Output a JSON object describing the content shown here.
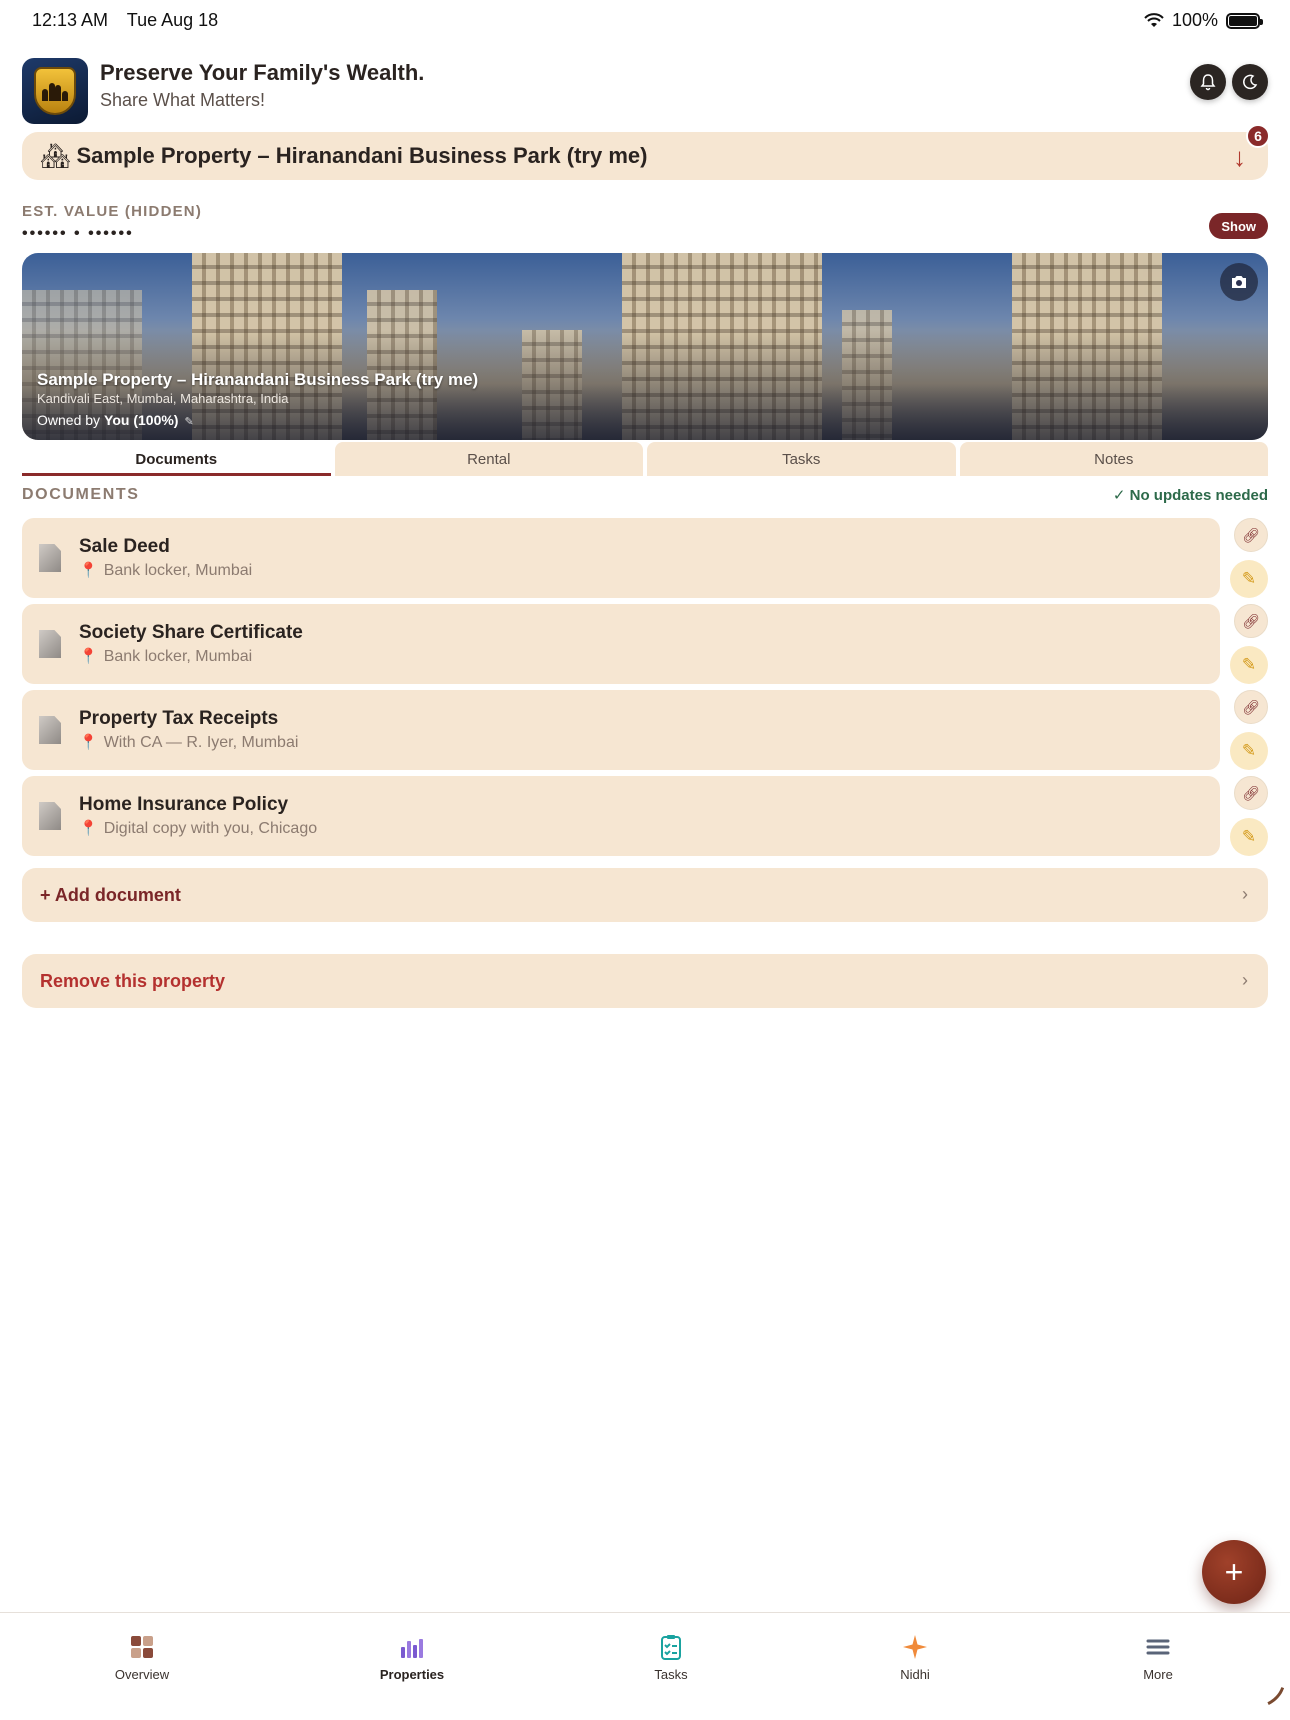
{
  "status_bar": {
    "time": "12:13 AM",
    "date": "Tue Aug 18",
    "battery": "100%"
  },
  "header": {
    "title": "Preserve Your Family's Wealth.",
    "subtitle": "Share What Matters!"
  },
  "property_selector": {
    "name": "Sample Property – Hiranandani Business Park (try me)",
    "badge_count": "6"
  },
  "est_value": {
    "label": "EST. VALUE (HIDDEN)",
    "masked": "•••••• • ••••••",
    "show_label": "Show"
  },
  "hero": {
    "title": "Sample Property – Hiranandani Business Park (try me)",
    "location": "Kandivali East, Mumbai, Maharashtra, India",
    "owned_prefix": "Owned by",
    "owner": "You (100%)"
  },
  "tabs": [
    {
      "label": "Documents"
    },
    {
      "label": "Rental"
    },
    {
      "label": "Tasks"
    },
    {
      "label": "Notes"
    }
  ],
  "documents": {
    "section_title": "DOCUMENTS",
    "status": "✓ No updates needed",
    "items": [
      {
        "title": "Sale Deed",
        "location": "Bank locker, Mumbai"
      },
      {
        "title": "Society Share Certificate",
        "location": "Bank locker, Mumbai"
      },
      {
        "title": "Property Tax Receipts",
        "location": "With CA — R. Iyer, Mumbai"
      },
      {
        "title": "Home Insurance Policy",
        "location": "Digital copy with you, Chicago"
      }
    ],
    "add_label": "+ Add document",
    "remove_label": "Remove this property"
  },
  "fab": {
    "label": "+"
  },
  "bottom_nav": [
    {
      "label": "Overview",
      "icon": "overview-grid-icon"
    },
    {
      "label": "Properties",
      "icon": "properties-chart-icon"
    },
    {
      "label": "Tasks",
      "icon": "tasks-clipboard-icon"
    },
    {
      "label": "Nidhi",
      "icon": "sparkle-icon"
    },
    {
      "label": "More",
      "icon": "menu-icon"
    }
  ],
  "colors": {
    "accent": "#7a2628",
    "card": "#f6e6d2",
    "success": "#2d6a4a"
  }
}
